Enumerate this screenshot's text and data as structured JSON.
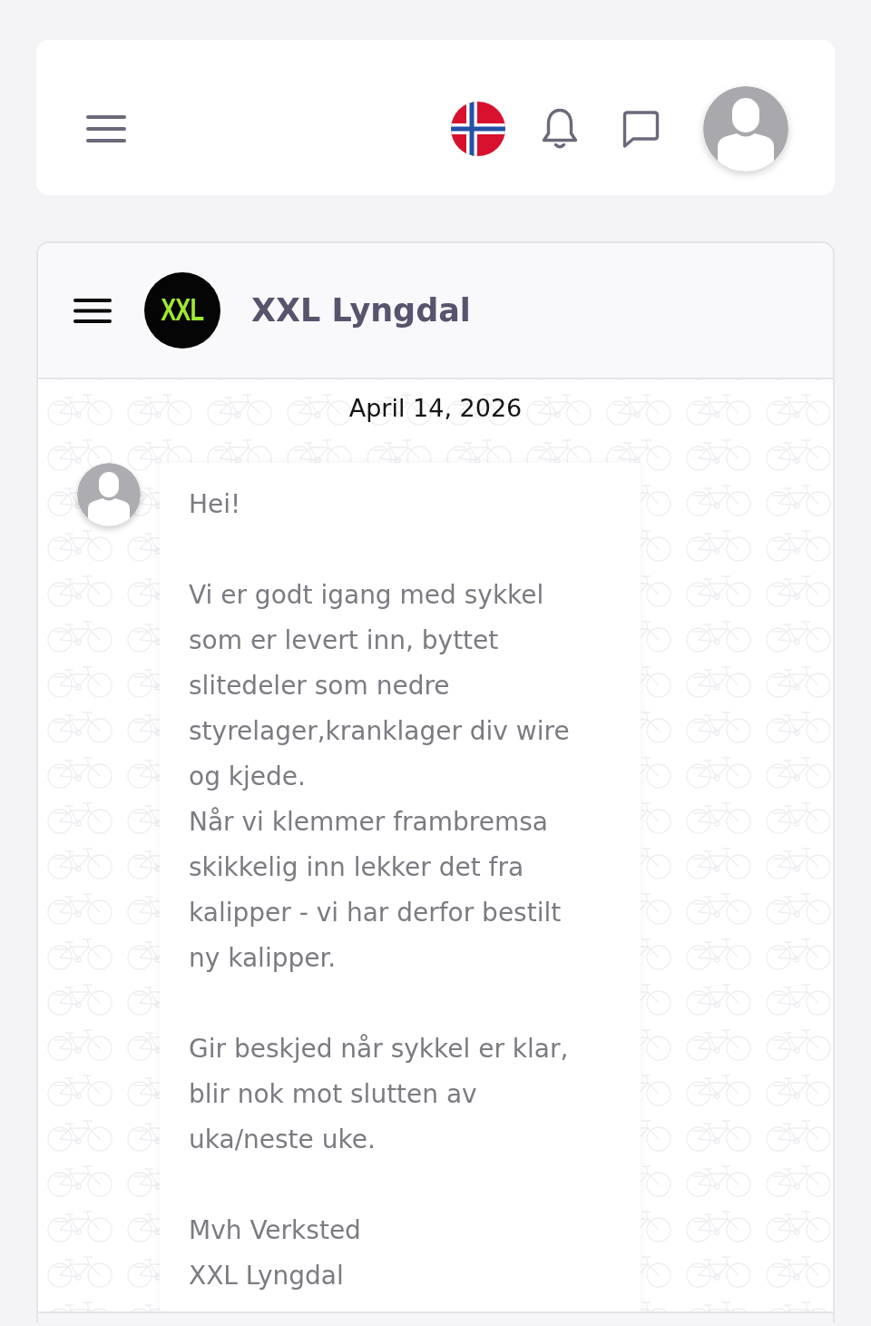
{
  "chat_header": {
    "logo_text": "XXL",
    "title": "XXL Lyngdal"
  },
  "conversation": {
    "date": "April 14, 2026",
    "messages": [
      {
        "text": "Hei!\n\nVi er godt igang med sykkel som er levert inn, byttet slitedeler som nedre styrelager,kranklager div wire og kjede.\nNår vi klemmer frambremsa skikkelig inn lekker det fra kalipper - vi har derfor bestilt ny kalipper.\n\nGir beskjed når sykkel er klar, blir nok mot slutten av uka/neste uke.\n\nMvh Verksted\nXXL Lyngdal"
      }
    ]
  }
}
